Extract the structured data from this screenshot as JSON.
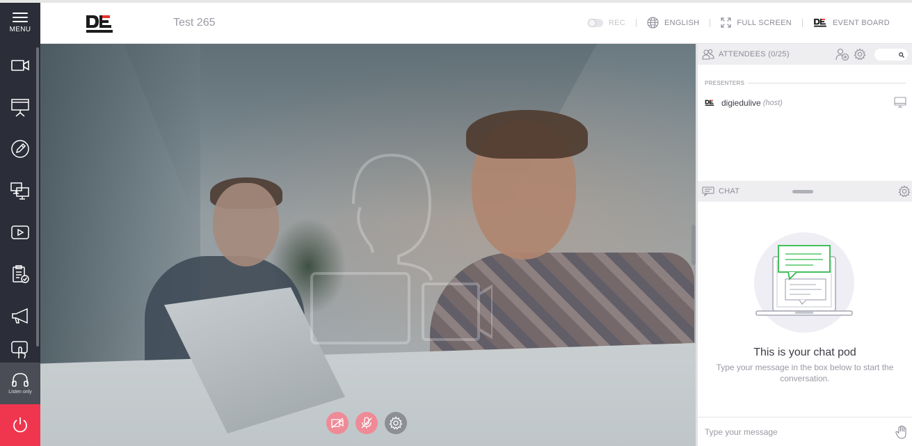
{
  "header": {
    "title": "Test 265",
    "rec_label": "REC",
    "language_label": "ENGLISH",
    "fullscreen_label": "FULL SCREEN",
    "eventboard_label": "EVENT BOARD"
  },
  "sidebar": {
    "menu_label": "MENU",
    "items": [
      {
        "name": "camera-icon"
      },
      {
        "name": "presentation-icon"
      },
      {
        "name": "whiteboard-icon"
      },
      {
        "name": "screen-share-icon"
      },
      {
        "name": "video-play-icon"
      },
      {
        "name": "poll-icon"
      },
      {
        "name": "announcement-icon"
      },
      {
        "name": "interaction-icon"
      }
    ],
    "listen_label": "Listen only"
  },
  "panel": {
    "attendees_label": "ATTENDEES (0/25)",
    "presenters_label": "PRESENTERS",
    "presenter": {
      "name": "digiedulive",
      "role": "(host)"
    },
    "chat_label": "CHAT",
    "chat_title": "This is your chat pod",
    "chat_subtitle": "Type your message in the box below to start the conversation.",
    "chat_placeholder": "Type your message"
  },
  "colors": {
    "sidebar": "#2b2d38",
    "power": "#f0364f",
    "accent_green": "#2fb94a",
    "control_red": "#ef8a97"
  }
}
